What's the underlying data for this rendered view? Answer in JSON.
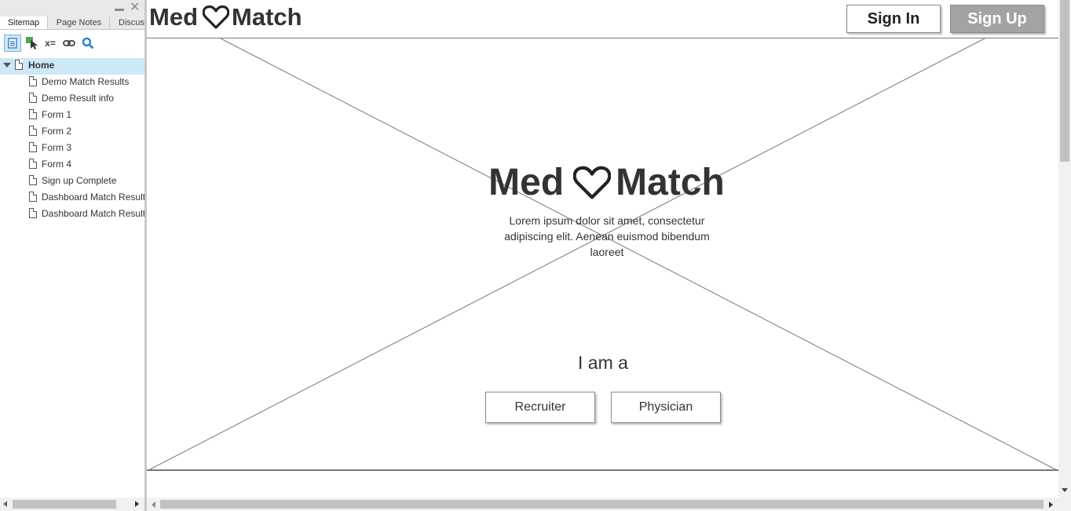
{
  "panel": {
    "tabs": [
      {
        "label": "Sitemap",
        "active": true
      },
      {
        "label": "Page Notes",
        "active": false
      },
      {
        "label": "Discus",
        "active": false
      }
    ],
    "toolbar": {
      "icons": [
        "page-icon",
        "add-interaction-icon",
        "variables-icon",
        "link-icon",
        "search-icon"
      ],
      "variables_label": "x="
    },
    "tree": {
      "root": "Home",
      "children": [
        "Demo Match Results",
        "Demo Result info",
        "Form 1",
        "Form 2",
        "Form 3",
        "Form 4",
        "Sign up Complete",
        "Dashboard Match Results",
        "Dashboard Match Results"
      ]
    }
  },
  "header": {
    "logo_left": "Med",
    "logo_right": "Match",
    "signin_label": "Sign In",
    "signup_label": "Sign Up"
  },
  "hero": {
    "logo_left": "Med",
    "logo_right": "Match",
    "description": "Lorem ipsum dolor sit amet, consectetur adipiscing elit. Aenean euismod bibendum laoreet",
    "prompt": "I am a",
    "buttons": {
      "recruiter": "Recruiter",
      "physician": "Physician"
    }
  },
  "colors": {
    "signup_bg": "#a3a3a3",
    "selected_row": "#cde8f7",
    "text": "#333333"
  }
}
